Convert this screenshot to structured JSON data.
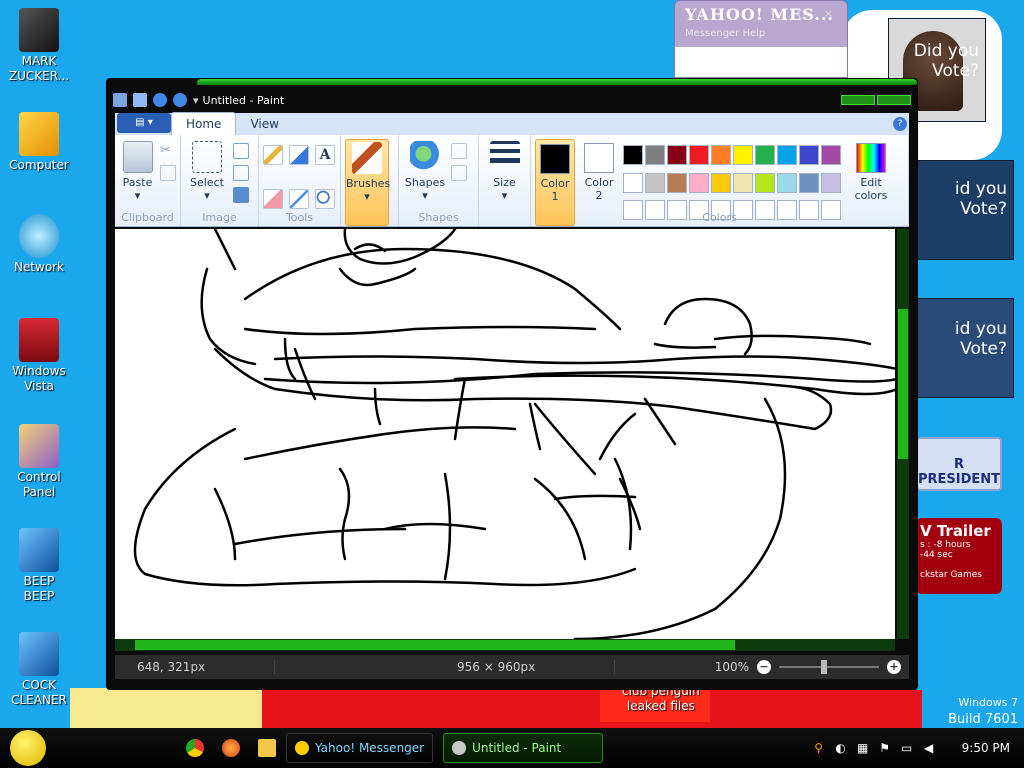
{
  "desktop": {
    "icons": [
      {
        "label": "MARK\nZUCKER...",
        "color": "#2c2c2c"
      },
      {
        "label": "Computer",
        "color": "#f1b81c"
      },
      {
        "label": "Network",
        "color": "#2aa9e0"
      },
      {
        "label": "Windows\nVista",
        "color": "#c0202a"
      },
      {
        "label": "Control\nPanel",
        "color": "#e89a2a"
      },
      {
        "label": "BEEP\nBEEP",
        "color": "#1e78c8"
      },
      {
        "label": "COCK\nCLEANER",
        "color": "#1e78c8"
      }
    ],
    "club_penguin": "club penguin\nleaked files",
    "windows_label": "Windows 7",
    "build_label": "Build 7601"
  },
  "yahoo_window": {
    "title": "YAHOO! MES...",
    "subtitle": "Messenger   Help"
  },
  "sidebar_ads": {
    "cand1": "Did you\nVote?",
    "cand2": "id you\nVote?",
    "cand3": "id you\nVote?",
    "president": "R PRESIDENT",
    "gta_title": "V Trailer",
    "gta_line1": "s : -8 hours",
    "gta_line2": "-44 sec",
    "gta_brand": "ckstar Games"
  },
  "paint": {
    "title": "Untitled - Paint",
    "tabs": [
      "Home",
      "View"
    ],
    "groups": {
      "clipboard": "Clipboard",
      "image": "Image",
      "tools": "Tools",
      "shapes": "Shapes",
      "colors": "Colors"
    },
    "buttons": {
      "paste": "Paste",
      "select": "Select",
      "brushes": "Brushes",
      "shapes": "Shapes",
      "size": "Size",
      "color1": "Color\n1",
      "color2": "Color\n2",
      "edit_colors": "Edit\ncolors",
      "text_tool": "A"
    },
    "palette": [
      "#000000",
      "#7f7f7f",
      "#880015",
      "#ed1c24",
      "#ff7f27",
      "#fff200",
      "#22b14c",
      "#00a2e8",
      "#3f48cc",
      "#a349a4",
      "#ffffff",
      "#c3c3c3",
      "#b97a57",
      "#ffaec9",
      "#ffc90e",
      "#efe4b0",
      "#b5e61d",
      "#99d9ea",
      "#7092be",
      "#c8bfe7",
      "#ffffff",
      "#ffffff",
      "#ffffff",
      "#ffffff",
      "#ffffff",
      "#ffffff",
      "#ffffff",
      "#ffffff",
      "#ffffff",
      "#ffffff"
    ],
    "color1": "#000000",
    "color2": "#ffffff",
    "status": {
      "cursor": "648, 321px",
      "canvas_size": "956 × 960px",
      "zoom": "100%"
    }
  },
  "taskbar": {
    "tasks": [
      "Yahoo! Messenger",
      "Untitled - Paint"
    ],
    "clock": "9:50 PM"
  }
}
